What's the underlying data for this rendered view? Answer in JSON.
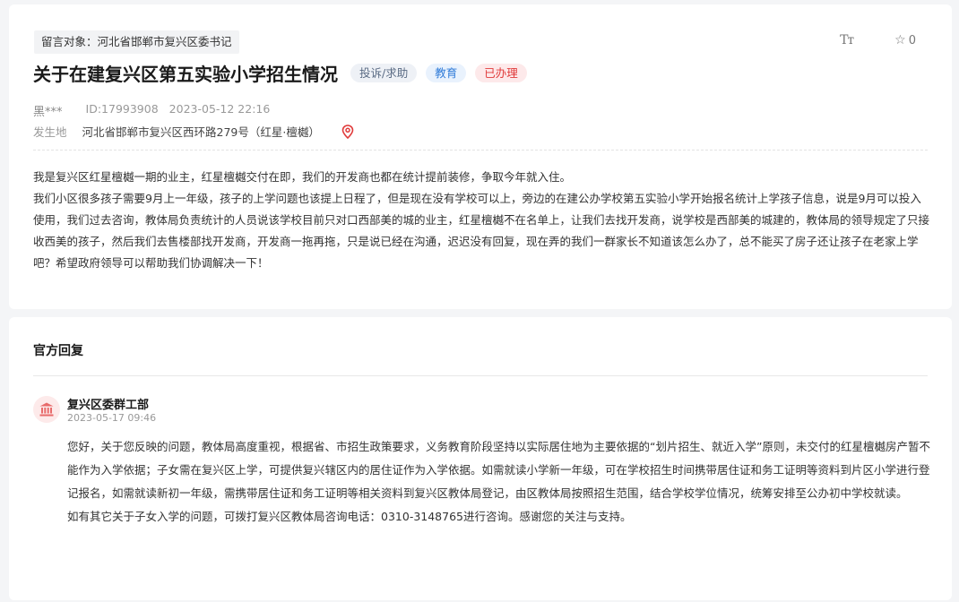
{
  "message": {
    "target": "留言对象：河北省邯郸市复兴区委书记",
    "font_size_icon": "Tт",
    "star_count": "0",
    "title": "关于在建复兴区第五实验小学招生情况",
    "tags": [
      "投诉/求助",
      "教育",
      "已办理"
    ],
    "user": "黑***",
    "id": "ID:17993908",
    "time": "2023-05-12 22:16",
    "location_label": "发生地",
    "location": "河北省邯郸市复兴区西环路279号（红星·檀樾）",
    "paragraphs": [
      "我是复兴区红星檀樾一期的业主，红星檀樾交付在即，我们的开发商也都在统计提前装修，争取今年就入住。",
      "我们小区很多孩子需要9月上一年级，孩子的上学问题也该提上日程了，但是现在没有学校可以上，旁边的在建公办学校第五实验小学开始报名统计上学孩子信息，说是9月可以投入使用，我们过去咨询，教体局负责统计的人员说该学校目前只对口西部美的城的业主，红星檀樾不在名单上，让我们去找开发商，说学校是西部美的城建的，教体局的领导规定了只接收西美的孩子，然后我们去售楼部找开发商，开发商一拖再拖，只是说已经在沟通，迟迟没有回复，现在弄的我们一群家长不知道该怎么办了，总不能买了房子还让孩子在老家上学吧？希望政府领导可以帮助我们协调解决一下！"
    ]
  },
  "reply": {
    "section_title": "官方回复",
    "dept": "复兴区委群工部",
    "time": "2023-05-17 09:46",
    "paragraphs": [
      "您好，关于您反映的问题，教体局高度重视，根据省、市招生政策要求，义务教育阶段坚持以实际居住地为主要依据的“划片招生、就近入学”原则，未交付的红星檀樾房产暂不能作为入学依据；子女需在复兴区上学，可提供复兴辖区内的居住证作为入学依据。如需就读小学新一年级，可在学校招生时间携带居住证和务工证明等资料到片区小学进行登记报名，如需就读新初一年级，需携带居住证和务工证明等相关资料到复兴区教体局登记，由区教体局按照招生范围，结合学校学位情况，统筹安排至公办初中学校就读。",
      "如有其它关于子女入学的问题，可拨打复兴区教体局咨询电话：0310-3148765进行咨询。感谢您的关注与支持。"
    ]
  },
  "icons": {
    "star": "star-outline-icon",
    "location": "map-pin-icon",
    "dept": "government-building-icon"
  },
  "colors": {
    "status_red": "#e03a3a",
    "category_blue": "#2f7bd8"
  }
}
